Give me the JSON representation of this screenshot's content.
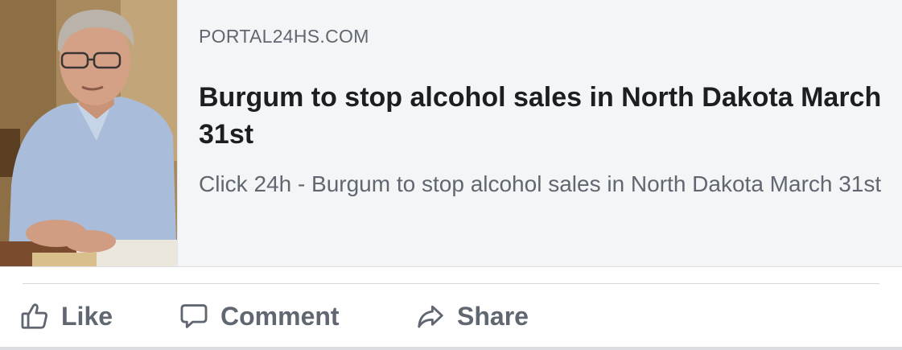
{
  "link_preview": {
    "domain": "PORTAL24HS.COM",
    "headline": "Burgum to stop alcohol sales in North Dakota March 31st",
    "description": "Click 24h - Burgum to stop alcohol sales in North Dakota March 31st",
    "thumbnail_icon": "man-at-desk-photo"
  },
  "actions": {
    "like_label": "Like",
    "like_icon": "thumbs-up-icon",
    "comment_label": "Comment",
    "comment_icon": "speech-bubble-icon",
    "share_label": "Share",
    "share_icon": "share-arrow-icon"
  },
  "colors": {
    "card_background": "#f4f5f7",
    "headline_text": "#1c1e21",
    "secondary_text": "#616770",
    "action_text": "#606770"
  }
}
